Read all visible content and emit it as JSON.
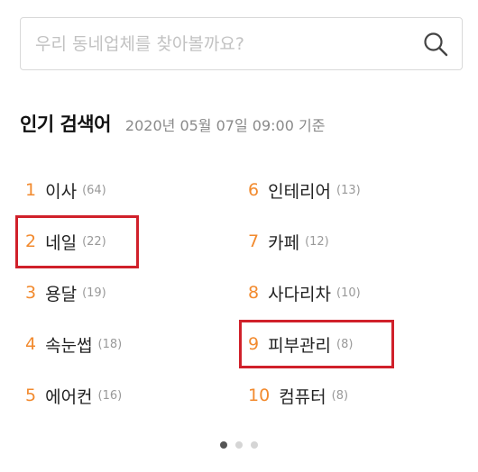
{
  "search": {
    "placeholder": "우리 동네업체를 찾아볼까요?",
    "value": ""
  },
  "popular": {
    "title": "인기 검색어",
    "timestamp": "2020년 05월 07일 09:00 기준",
    "items": [
      {
        "rank": "1",
        "term": "이사",
        "count": "(64)"
      },
      {
        "rank": "2",
        "term": "네일",
        "count": "(22)"
      },
      {
        "rank": "3",
        "term": "용달",
        "count": "(19)"
      },
      {
        "rank": "4",
        "term": "속눈썹",
        "count": "(18)"
      },
      {
        "rank": "5",
        "term": "에어컨",
        "count": "(16)"
      },
      {
        "rank": "6",
        "term": "인테리어",
        "count": "(13)"
      },
      {
        "rank": "7",
        "term": "카페",
        "count": "(12)"
      },
      {
        "rank": "8",
        "term": "사다리차",
        "count": "(10)"
      },
      {
        "rank": "9",
        "term": "피부관리",
        "count": "(8)"
      },
      {
        "rank": "10",
        "term": "컴퓨터",
        "count": "(8)"
      }
    ]
  },
  "pagination": {
    "total": 3,
    "active": 1
  },
  "colors": {
    "rank_number": "#f28a2e",
    "highlight": "#d0202a",
    "dot_active": "#555555",
    "dot_inactive": "#d5d5d5"
  },
  "icons": {
    "search_button": "search-icon"
  }
}
